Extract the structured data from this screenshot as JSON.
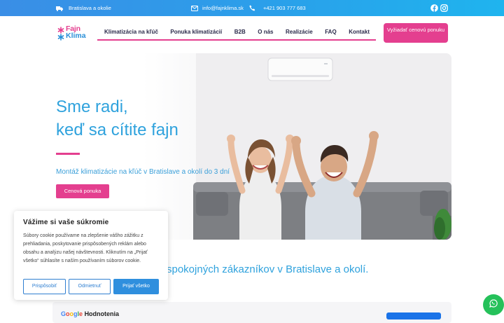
{
  "topbar": {
    "location": "Bratislava a okolie",
    "email": "info@fajnklima.sk",
    "phone": "+421 903 777 683"
  },
  "logo": {
    "line1": "Fajn",
    "line2": "Klima"
  },
  "nav": {
    "items": [
      "Klimatizácia na kľúč",
      "Ponuka klimatizácií",
      "B2B",
      "O nás",
      "Realizácie",
      "FAQ",
      "Kontakt"
    ],
    "cta": "Vyžiadať cenovú ponuku"
  },
  "hero": {
    "title_line1": "Sme radi,",
    "title_line2": "keď sa cítite fajn",
    "subtitle": "Montáž klimatizácie na kľúč v Bratislave a okolí do 3 dní",
    "button": "Cenová ponuka"
  },
  "tagline": "spokojných zákazníkov v Bratislave a okolí.",
  "reviews": {
    "google": "Google",
    "label": "Hodnotenia"
  },
  "cookie": {
    "title": "Vážime si vaše súkromie",
    "text": "Súbory cookie používame na zlepšenie vášho zážitku z prehliadania, poskytovanie prispôsobených reklám alebo obsahu a analýzu našej návštevnosti. Kliknutím na „Prijať všetko“ súhlasíte s naším používaním súborov cookie.",
    "customize": "Prispôsobiť",
    "reject": "Odmietnuť",
    "accept": "Prijať všetko"
  },
  "colors": {
    "brand_pink": "#e43f8f",
    "brand_blue": "#2fa2dd",
    "whatsapp": "#25c15a"
  },
  "icons": [
    "truck-icon",
    "email-icon",
    "phone-icon",
    "facebook-icon",
    "instagram-icon",
    "whatsapp-icon",
    "snowflake-icon"
  ]
}
